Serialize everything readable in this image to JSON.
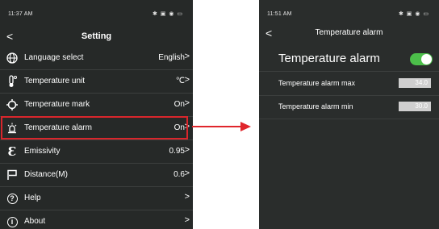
{
  "left_phone": {
    "status_time": "11:37 AM",
    "status_icons": "✱ ▣ ◉ ▭",
    "title": "Setting",
    "back_glyph": "<",
    "items": [
      {
        "label": "Language select",
        "value": "English",
        "chevron": ">",
        "icon": "globe-icon"
      },
      {
        "label": "Temperature unit",
        "value": "℃",
        "chevron": ">",
        "icon": "thermometer-icon"
      },
      {
        "label": "Temperature mark",
        "value": "On",
        "chevron": ">",
        "icon": "crosshair-icon"
      },
      {
        "label": "Temperature alarm",
        "value": "On",
        "chevron": ">",
        "icon": "alarm-icon"
      },
      {
        "label": "Emissivity",
        "value": "0.95",
        "chevron": ">",
        "icon": "epsilon-icon"
      },
      {
        "label": "Distance(M)",
        "value": "0.6",
        "chevron": ">",
        "icon": "flag-icon"
      },
      {
        "label": "Help",
        "value": "",
        "chevron": ">",
        "icon": "help-icon"
      },
      {
        "label": "About",
        "value": "",
        "chevron": ">",
        "icon": "info-icon"
      }
    ],
    "epsilon_glyph": "Ɛ",
    "help_glyph": "?",
    "info_glyph": "i"
  },
  "right_phone": {
    "status_time": "11:51 AM",
    "status_icons": "✱ ▣ ◉ ▭",
    "title": "Temperature alarm",
    "back_glyph": "<",
    "toggle_label": "Temperature alarm",
    "toggle_on": true,
    "alarm_max_label": "Temperature alarm max",
    "alarm_max_value": "34.0",
    "alarm_min_label": "Temperature alarm min",
    "alarm_min_value": "30.0"
  },
  "colors": {
    "background": "#262928",
    "highlight": "#d9262c",
    "arrow": "#e0262c",
    "toggle": "#4cbf4a"
  }
}
